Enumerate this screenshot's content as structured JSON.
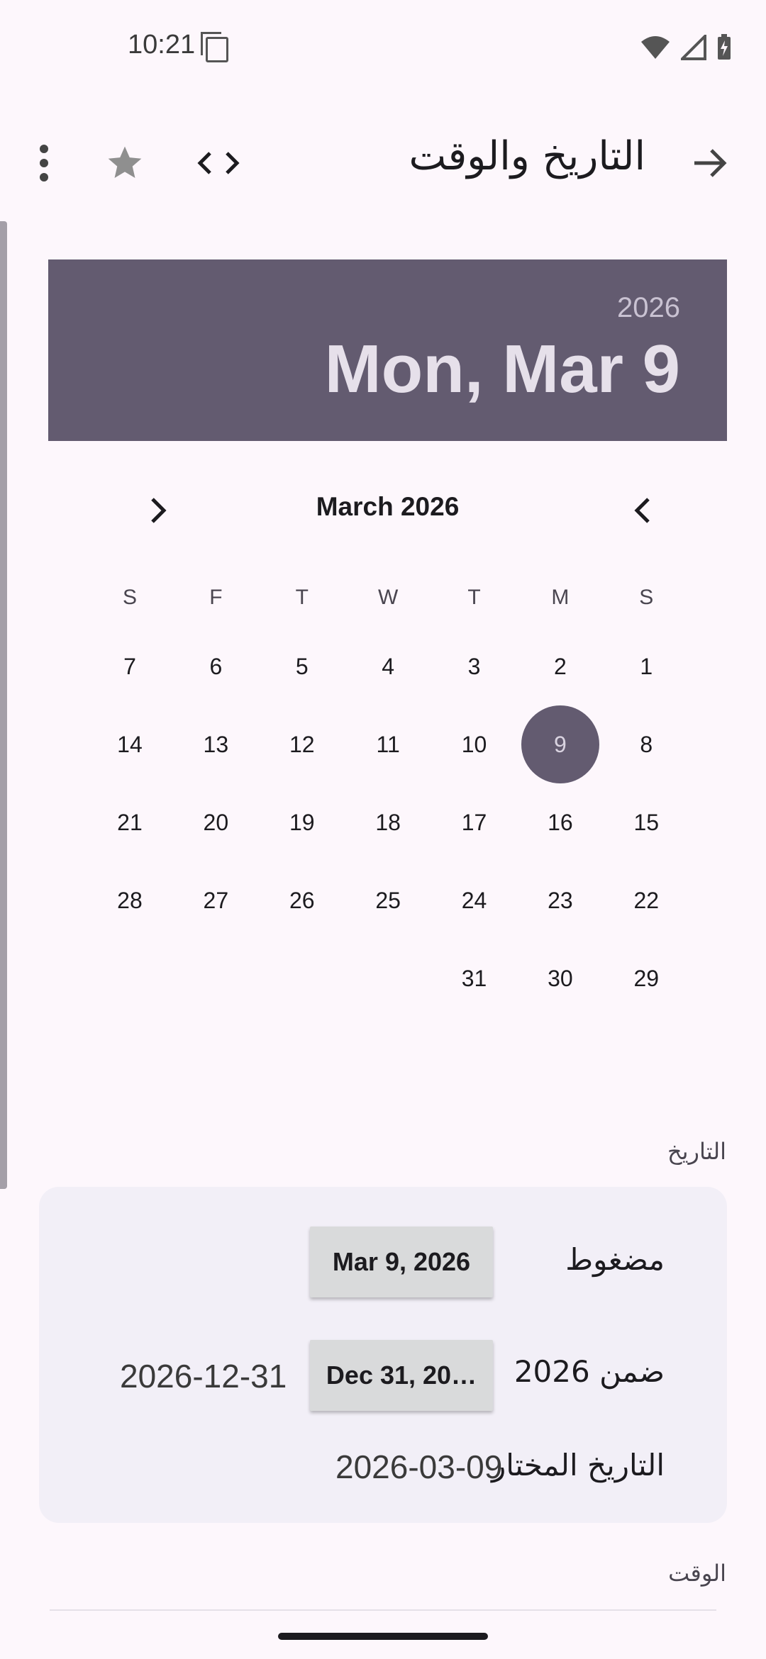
{
  "status": {
    "time": "10:21"
  },
  "appbar": {
    "title": "التاريخ والوقت"
  },
  "header": {
    "year": "2026",
    "date": "Mon, Mar 9"
  },
  "calendar": {
    "month_label": "March 2026",
    "weekdays": [
      "S",
      "M",
      "T",
      "W",
      "T",
      "F",
      "S"
    ],
    "weeks": [
      [
        "1",
        "2",
        "3",
        "4",
        "5",
        "6",
        "7"
      ],
      [
        "8",
        "9",
        "10",
        "11",
        "12",
        "13",
        "14"
      ],
      [
        "15",
        "16",
        "17",
        "18",
        "19",
        "20",
        "21"
      ],
      [
        "22",
        "23",
        "24",
        "25",
        "26",
        "27",
        "28"
      ],
      [
        "29",
        "30",
        "31",
        "",
        "",
        "",
        ""
      ]
    ],
    "selected": "9"
  },
  "date_section": {
    "label": "التاريخ",
    "pressed_label": "مضغوط",
    "pressed_button": "Mar 9, 2026",
    "within_label": "ضمن 2026",
    "within_button": "Dec 31, 20…",
    "within_value": "2026-12-31",
    "selected_label": "التاريخ المختار",
    "selected_value": "2026-03-09"
  },
  "time_section": {
    "label": "الوقت"
  }
}
